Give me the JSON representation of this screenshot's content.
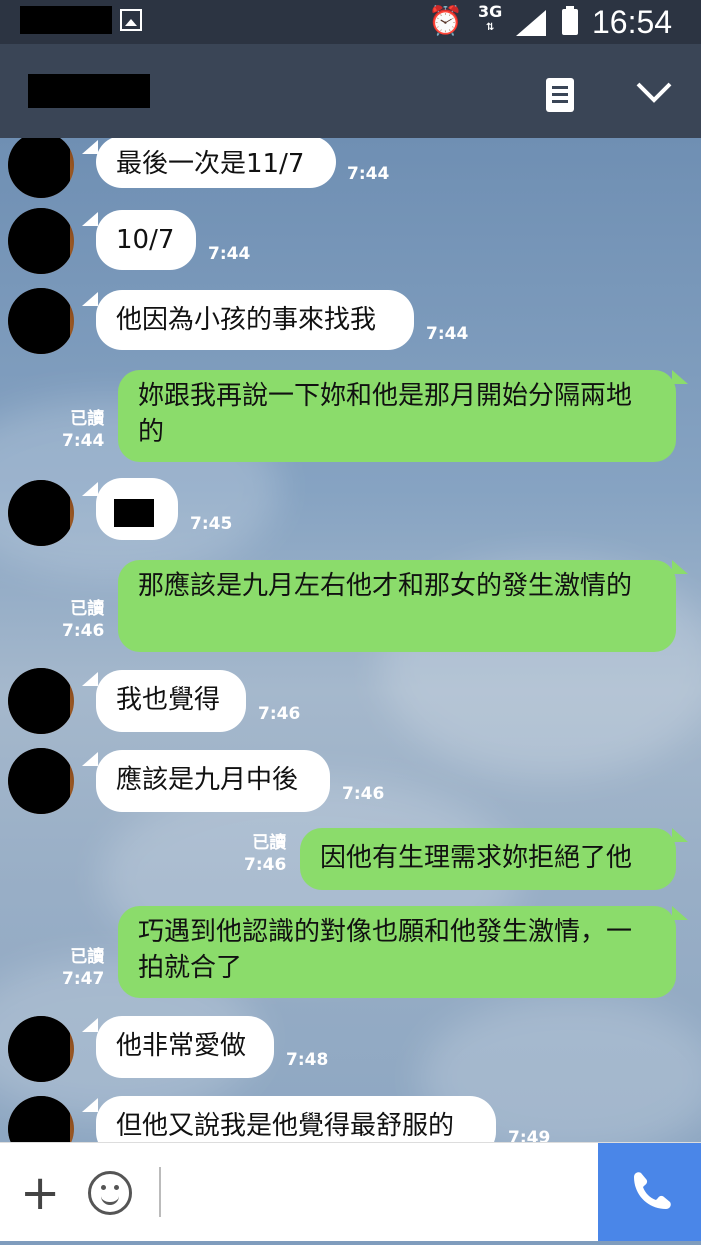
{
  "status_bar": {
    "network": "3G",
    "time": "16:54",
    "alarm_icon": "alarm-clock-icon",
    "signal_icon": "signal-icon",
    "battery_icon": "battery-icon"
  },
  "header": {
    "menu_icon": "list-menu-icon",
    "collapse_icon": "chevron-down-icon"
  },
  "messages": [
    {
      "side": "in",
      "text": "最後一次是11/7",
      "time": "7:44"
    },
    {
      "side": "in",
      "text": "10/7",
      "time": "7:44"
    },
    {
      "side": "in",
      "text": "他因為小孩的事來找我",
      "time": "7:44"
    },
    {
      "side": "out",
      "text": "妳跟我再說一下妳和他是那月開始分隔兩地的",
      "read": "已讀",
      "time": "7:44"
    },
    {
      "side": "in",
      "text": "",
      "time": "7:45"
    },
    {
      "side": "out",
      "text": "那應該是九月左右他才和那女的發生激情的",
      "read": "已讀",
      "time": "7:46"
    },
    {
      "side": "in",
      "text": "我也覺得",
      "time": "7:46"
    },
    {
      "side": "in",
      "text": "應該是九月中後",
      "time": "7:46"
    },
    {
      "side": "out",
      "text": "因他有生理需求妳拒絕了他",
      "read": "已讀",
      "time": "7:46"
    },
    {
      "side": "out",
      "text": "巧遇到他認識的對像也願和他發生激情，一拍就合了",
      "read": "已讀",
      "time": "7:47"
    },
    {
      "side": "in",
      "text": "他非常愛做",
      "time": "7:48"
    },
    {
      "side": "in",
      "text": "但他又說我是他覺得最舒服的",
      "time": "7:49"
    }
  ],
  "input_bar": {
    "plus_label": "+",
    "plus_icon": "plus-icon",
    "emoji_icon": "emoji-icon",
    "call_icon": "phone-icon"
  }
}
